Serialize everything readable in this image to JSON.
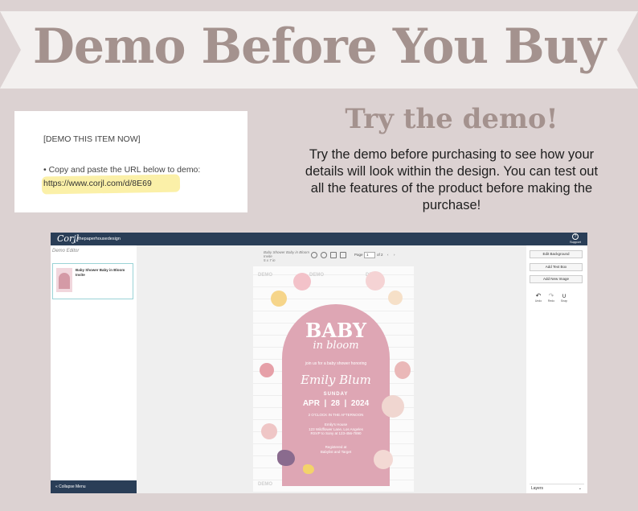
{
  "banner": {
    "title": "Demo Before You Buy"
  },
  "demo_card": {
    "heading": "[DEMO THIS ITEM NOW]",
    "instruction": "• Copy and paste the URL below to demo:",
    "url": "https://www.corjl.com/d/8E69"
  },
  "promo": {
    "title": "Try the demo!",
    "body": "Try the demo before purchasing to see how your details will look within the design. You can test out all the features of the product before making the purchase!"
  },
  "app": {
    "logo": "Corjl",
    "shop_name": "thepaperhousedesign",
    "help_icon": "?",
    "support_label": "Support",
    "sidebar": {
      "title": "Demo Editor",
      "item_label": "Baby Shower Baby in Bloom Invite",
      "collapse_label": "« Collapse Menu"
    },
    "document": {
      "title": "Baby Shower Baby in Bloom Invite",
      "size": "5 x 7 in",
      "page_label": "Page",
      "page_value": "1",
      "page_total": "of 2"
    },
    "invitation": {
      "watermark": "DEMO",
      "baby": "BABY",
      "bloom": "in bloom",
      "join": "join us for a baby shower honoring",
      "name": "Emily Blum",
      "day": "SUNDAY",
      "month": "APR",
      "date_num": "28",
      "year": "2024",
      "time": "2 O'CLOCK IN THE AFTERNOON",
      "venue_1": "Emily's House",
      "venue_2": "123 Wildflower Lane, Los Angeles",
      "venue_3": "RSVP to Sony at 123-456-7890",
      "host_1": "Registered at",
      "host_2": "Babylist and Target"
    },
    "right_panel": {
      "edit_background": "Edit Background",
      "add_text_box": "Add Text Box",
      "add_new_image": "Add New Image",
      "undo_label": "Undo",
      "redo_label": "Redo",
      "snap_label": "Snap",
      "layers_label": "Layers"
    }
  },
  "colors": {
    "background": "#dcd2d2",
    "title_mauve": "#a4928e",
    "navbar": "#2a3e57",
    "arch_pink": "#dea6b4",
    "highlight": "#fbf0a8"
  }
}
